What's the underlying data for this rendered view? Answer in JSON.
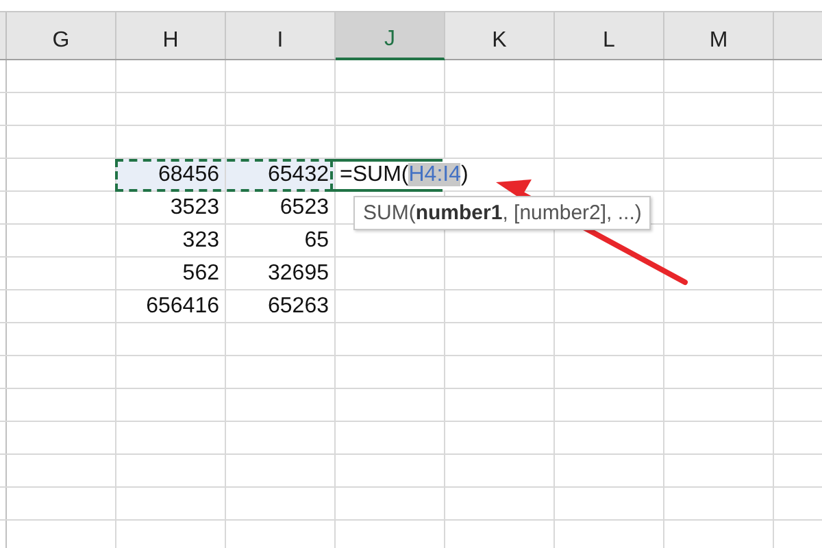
{
  "columns": [
    {
      "label": "G",
      "selected": false
    },
    {
      "label": "H",
      "selected": false
    },
    {
      "label": "I",
      "selected": false
    },
    {
      "label": "J",
      "selected": true
    },
    {
      "label": "K",
      "selected": false
    },
    {
      "label": "L",
      "selected": false
    },
    {
      "label": "M",
      "selected": false
    }
  ],
  "rows": [
    {
      "cells": [
        "68456",
        "65432"
      ],
      "in_range": true
    },
    {
      "cells": [
        "3523",
        "6523"
      ],
      "in_range": false
    },
    {
      "cells": [
        "323",
        "65"
      ],
      "in_range": false
    },
    {
      "cells": [
        "562",
        "32695"
      ],
      "in_range": false
    },
    {
      "cells": [
        "656416",
        "65263"
      ],
      "in_range": false
    }
  ],
  "formula": {
    "prefix": "=SUM(",
    "reference": "H4:I4",
    "suffix": ")"
  },
  "tooltip": {
    "text": "SUM(**number1**, [number2], ...)"
  }
}
